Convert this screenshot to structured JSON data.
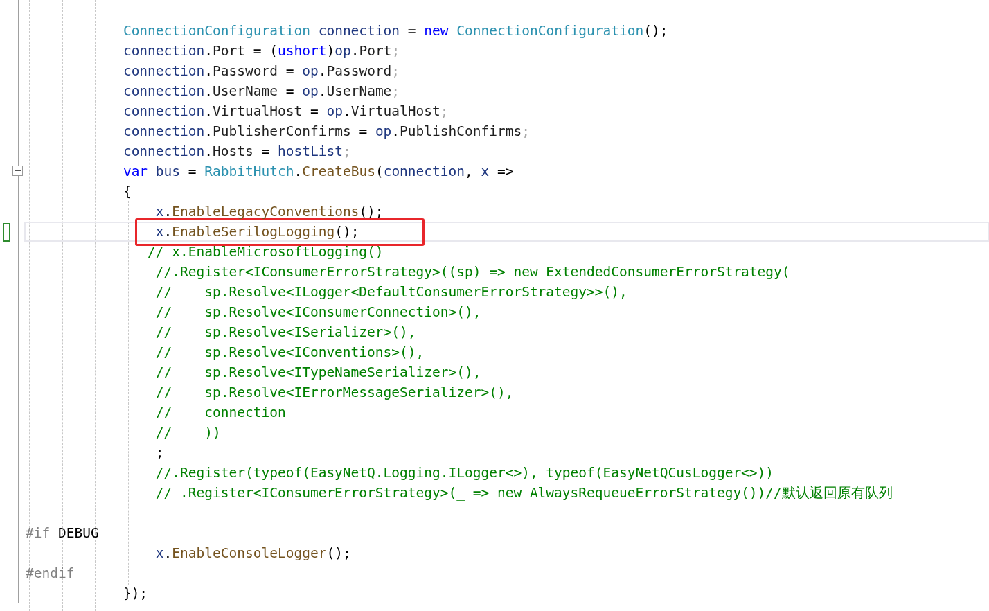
{
  "editor": {
    "lines": [
      {
        "tokens": [
          {
            "kind": "type",
            "text": "            ConnectionConfiguration"
          },
          {
            "kind": "local",
            "text": " connection"
          },
          {
            "kind": "plain",
            "text": " = "
          },
          {
            "kind": "kw",
            "text": "new"
          },
          {
            "kind": "type",
            "text": " ConnectionConfiguration"
          },
          {
            "kind": "plain",
            "text": "();"
          }
        ]
      },
      {
        "tokens": [
          {
            "kind": "local",
            "text": "            connection"
          },
          {
            "kind": "plain",
            "text": "."
          },
          {
            "kind": "prop",
            "text": "Port"
          },
          {
            "kind": "plain",
            "text": " = ("
          },
          {
            "kind": "kw",
            "text": "ushort"
          },
          {
            "kind": "plain",
            "text": ")"
          },
          {
            "kind": "local",
            "text": "op"
          },
          {
            "kind": "plain",
            "text": "."
          },
          {
            "kind": "prop",
            "text": "Port"
          },
          {
            "kind": "semi",
            "text": ";"
          }
        ]
      },
      {
        "tokens": [
          {
            "kind": "local",
            "text": "            connection"
          },
          {
            "kind": "plain",
            "text": "."
          },
          {
            "kind": "prop",
            "text": "Password"
          },
          {
            "kind": "plain",
            "text": " = "
          },
          {
            "kind": "local",
            "text": "op"
          },
          {
            "kind": "plain",
            "text": "."
          },
          {
            "kind": "prop",
            "text": "Password"
          },
          {
            "kind": "semi",
            "text": ";"
          }
        ]
      },
      {
        "tokens": [
          {
            "kind": "local",
            "text": "            connection"
          },
          {
            "kind": "plain",
            "text": "."
          },
          {
            "kind": "prop",
            "text": "UserName"
          },
          {
            "kind": "plain",
            "text": " = "
          },
          {
            "kind": "local",
            "text": "op"
          },
          {
            "kind": "plain",
            "text": "."
          },
          {
            "kind": "prop",
            "text": "UserName"
          },
          {
            "kind": "semi",
            "text": ";"
          }
        ]
      },
      {
        "tokens": [
          {
            "kind": "local",
            "text": "            connection"
          },
          {
            "kind": "plain",
            "text": "."
          },
          {
            "kind": "prop",
            "text": "VirtualHost"
          },
          {
            "kind": "plain",
            "text": " = "
          },
          {
            "kind": "local",
            "text": "op"
          },
          {
            "kind": "plain",
            "text": "."
          },
          {
            "kind": "prop",
            "text": "VirtualHost"
          },
          {
            "kind": "semi",
            "text": ";"
          }
        ]
      },
      {
        "tokens": [
          {
            "kind": "local",
            "text": "            connection"
          },
          {
            "kind": "plain",
            "text": "."
          },
          {
            "kind": "prop",
            "text": "PublisherConfirms"
          },
          {
            "kind": "plain",
            "text": " = "
          },
          {
            "kind": "local",
            "text": "op"
          },
          {
            "kind": "plain",
            "text": "."
          },
          {
            "kind": "prop",
            "text": "PublishConfirms"
          },
          {
            "kind": "semi",
            "text": ";"
          }
        ]
      },
      {
        "tokens": [
          {
            "kind": "local",
            "text": "            connection"
          },
          {
            "kind": "plain",
            "text": "."
          },
          {
            "kind": "prop",
            "text": "Hosts"
          },
          {
            "kind": "plain",
            "text": " = "
          },
          {
            "kind": "local",
            "text": "hostList"
          },
          {
            "kind": "semi",
            "text": ";"
          }
        ]
      },
      {
        "collapsible": true,
        "tokens": [
          {
            "kind": "kw",
            "text": "            var"
          },
          {
            "kind": "local",
            "text": " bus"
          },
          {
            "kind": "plain",
            "text": " = "
          },
          {
            "kind": "type",
            "text": "RabbitHutch"
          },
          {
            "kind": "plain",
            "text": "."
          },
          {
            "kind": "method",
            "text": "CreateBus"
          },
          {
            "kind": "plain",
            "text": "("
          },
          {
            "kind": "local",
            "text": "connection"
          },
          {
            "kind": "plain",
            "text": ", "
          },
          {
            "kind": "local",
            "text": "x"
          },
          {
            "kind": "plain",
            "text": " =>"
          }
        ]
      },
      {
        "tokens": [
          {
            "kind": "plain",
            "text": "            {"
          }
        ]
      },
      {
        "tokens": [
          {
            "kind": "local",
            "text": "                x"
          },
          {
            "kind": "plain",
            "text": "."
          },
          {
            "kind": "method",
            "text": "EnableLegacyConventions"
          },
          {
            "kind": "plain",
            "text": "();"
          }
        ]
      },
      {
        "current": true,
        "annotated": true,
        "tokens": [
          {
            "kind": "local",
            "text": "                x"
          },
          {
            "kind": "plain",
            "text": "."
          },
          {
            "kind": "method",
            "text": "EnableSerilogLogging"
          },
          {
            "kind": "plain",
            "text": "();"
          }
        ]
      },
      {
        "tokens": [
          {
            "kind": "comment",
            "text": "               // x.EnableMicrosoftLogging()"
          }
        ]
      },
      {
        "tokens": [
          {
            "kind": "comment",
            "text": "                //.Register<IConsumerErrorStrategy>((sp) => new ExtendedConsumerErrorStrategy("
          }
        ]
      },
      {
        "tokens": [
          {
            "kind": "comment",
            "text": "                //    sp.Resolve<ILogger<DefaultConsumerErrorStrategy>>(),"
          }
        ]
      },
      {
        "tokens": [
          {
            "kind": "comment",
            "text": "                //    sp.Resolve<IConsumerConnection>(),"
          }
        ]
      },
      {
        "tokens": [
          {
            "kind": "comment",
            "text": "                //    sp.Resolve<ISerializer>(),"
          }
        ]
      },
      {
        "tokens": [
          {
            "kind": "comment",
            "text": "                //    sp.Resolve<IConventions>(),"
          }
        ]
      },
      {
        "tokens": [
          {
            "kind": "comment",
            "text": "                //    sp.Resolve<ITypeNameSerializer>(),"
          }
        ]
      },
      {
        "tokens": [
          {
            "kind": "comment",
            "text": "                //    sp.Resolve<IErrorMessageSerializer>(),"
          }
        ]
      },
      {
        "tokens": [
          {
            "kind": "comment",
            "text": "                //    connection"
          }
        ]
      },
      {
        "tokens": [
          {
            "kind": "comment",
            "text": "                //    ))"
          }
        ]
      },
      {
        "tokens": [
          {
            "kind": "plain",
            "text": "                ;"
          }
        ]
      },
      {
        "tokens": [
          {
            "kind": "comment",
            "text": "                //.Register(typeof(EasyNetQ.Logging.ILogger<>), typeof(EasyNetQCusLogger<>))"
          }
        ]
      },
      {
        "tokens": [
          {
            "kind": "comment",
            "text": "                // .Register<IConsumerErrorStrategy>(_ => new AlwaysRequeueErrorStrategy())//默认返回原有队列"
          }
        ]
      },
      {
        "gap_before": true,
        "tokens": [
          {
            "kind": "preproc",
            "text": "#if"
          },
          {
            "kind": "plain",
            "text": " DEBUG"
          }
        ]
      },
      {
        "tokens": [
          {
            "kind": "local",
            "text": "                x"
          },
          {
            "kind": "plain",
            "text": "."
          },
          {
            "kind": "method",
            "text": "EnableConsoleLogger"
          },
          {
            "kind": "plain",
            "text": "();"
          }
        ]
      },
      {
        "tokens": [
          {
            "kind": "preproc",
            "text": "#endif"
          }
        ]
      },
      {
        "tokens": [
          {
            "kind": "plain",
            "text": "            });"
          }
        ]
      }
    ]
  }
}
